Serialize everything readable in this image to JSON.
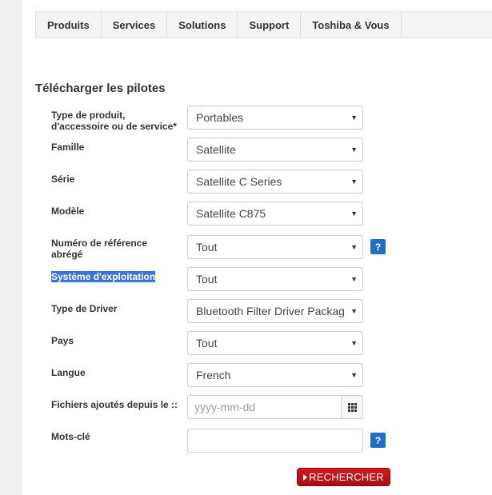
{
  "nav": {
    "items": [
      "Produits",
      "Services",
      "Solutions",
      "Support",
      "Toshiba & Vous"
    ]
  },
  "form": {
    "title": "Télécharger les pilotes",
    "product_type": {
      "label_line1": "Type de produit,",
      "label_line2": "d'accessoire ou de service*",
      "value": "Portables"
    },
    "family": {
      "label": "Famille",
      "value": "Satellite"
    },
    "series": {
      "label": "Série",
      "value": "Satellite C Series"
    },
    "model": {
      "label": "Modèle",
      "value": "Satellite C875"
    },
    "part_number": {
      "label_line1": "Numéro de référence",
      "label_line2": "abrégé",
      "value": "Tout"
    },
    "os": {
      "label": "Système d'exploitation",
      "value": "Tout"
    },
    "driver_type": {
      "label": "Type de Driver",
      "value": "Bluetooth Filter Driver Package"
    },
    "country": {
      "label": "Pays",
      "value": "Tout"
    },
    "language": {
      "label": "Langue",
      "value": "French"
    },
    "files_since": {
      "label": "Fichiers ajoutés depuis le ::",
      "placeholder": "yyyy-mm-dd",
      "value": ""
    },
    "keywords": {
      "label": "Mots-clé",
      "value": ""
    },
    "help_symbol": "?",
    "caret_symbol": "▼",
    "search_label": "RECHERCHER"
  },
  "colors": {
    "help_blue": "#1f6fc6",
    "search_red": "#c0141b",
    "selection_blue": "#3a73d9"
  }
}
